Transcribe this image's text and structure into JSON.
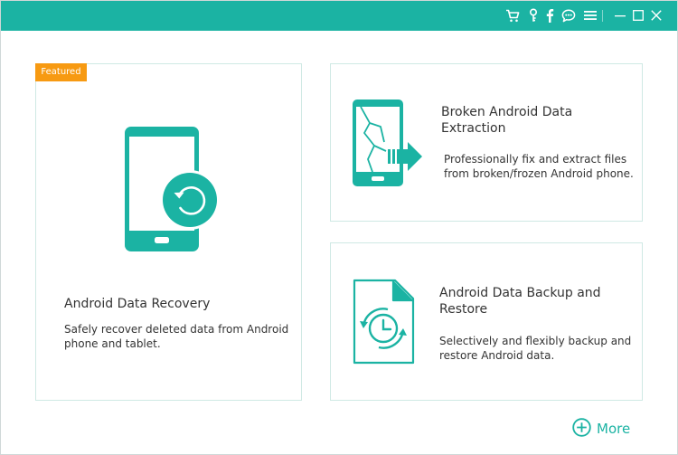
{
  "titlebar": {
    "icons": [
      "cart-icon",
      "key-icon",
      "facebook-icon",
      "chat-icon",
      "menu-icon"
    ],
    "window_controls": [
      "minimize-icon",
      "maximize-icon",
      "close-icon"
    ],
    "background_color": "#1bb3a3"
  },
  "cards": {
    "recovery": {
      "badge": "Featured",
      "title": "Android Data Recovery",
      "desc_line1": "Safely recover deleted data from Android",
      "desc_line2": "phone and tablet.",
      "icon": "phone-restore-icon"
    },
    "broken": {
      "title_line1": "Broken Android Data",
      "title_line2": "Extraction",
      "desc_line1": "Professionally fix and extract files",
      "desc_line2": "from broken/frozen Android phone.",
      "icon": "broken-phone-icon"
    },
    "backup": {
      "title_line1": "Android Data Backup and",
      "title_line2": "Restore",
      "desc_line1": "Selectively and flexibly backup and",
      "desc_line2": "restore Android data.",
      "icon": "backup-file-icon"
    }
  },
  "more": {
    "label": "More",
    "icon": "plus-circle-icon"
  },
  "colors": {
    "accent": "#1bb3a3",
    "badge": "#f79a12",
    "text": "#333333"
  }
}
